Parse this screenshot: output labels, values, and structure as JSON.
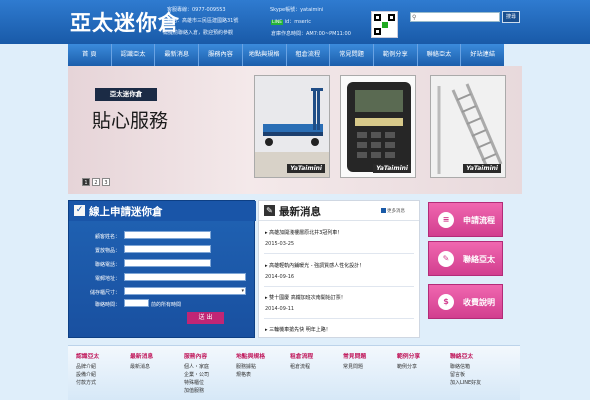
{
  "header": {
    "logo": "亞太迷你倉",
    "phone": "客服專線：0977-009553",
    "address": "地點：高雄市三民區建國路31號",
    "notice": "需提前聯絡入倉，歡迎預約參觀",
    "skype": "Skype帳號：yataimini",
    "line_label": "LINE",
    "line_id": "id：mseric",
    "hours": "倉庫作息時間：AM7:00~PM11:00",
    "search_btn": "搜尋"
  },
  "nav": [
    "首 頁",
    "認識亞太",
    "最新消息",
    "服務內容",
    "地點與規格",
    "租倉流程",
    "常見問題",
    "範例分享",
    "聯絡亞太",
    "好站連結"
  ],
  "banner": {
    "tag": "亞太迷你倉",
    "title": "貼心服務",
    "brand": "YaTaimini",
    "pages": [
      "1",
      "2",
      "3"
    ]
  },
  "form": {
    "title": "線上申請迷你倉",
    "fields": [
      "顧客姓名：",
      "置放物品：",
      "聯絡電話：",
      "電郵地址：",
      "儲存櫃尺寸：",
      "聯絡時間："
    ],
    "time_suffix": "前的所有時間",
    "send": "送 出"
  },
  "news": {
    "title": "最新消息",
    "more": "更多消息",
    "items": [
      {
        "title": "高雄加開淺樓層原北井3冠列車！",
        "date": "2015-03-25"
      },
      {
        "title": "高雄輕軌內鋪暖光 - 強調質感人性化設計！",
        "date": "2014-09-16"
      },
      {
        "title": "雙十國慶 高鐵加班次南開始訂票！",
        "date": "2014-09-11"
      },
      {
        "title": "三輪機車搶先快 明年上路！",
        "date": ""
      }
    ]
  },
  "side_buttons": [
    {
      "label": "申請流程",
      "icon": "≡"
    },
    {
      "label": "聯絡亞太",
      "icon": "✎"
    },
    {
      "label": "收費說明",
      "icon": "$"
    }
  ],
  "footer": [
    {
      "h": "認識亞太",
      "links": [
        "品牌介紹",
        "設備介紹",
        "付款方式"
      ]
    },
    {
      "h": "最新消息",
      "links": [
        "最新消息"
      ]
    },
    {
      "h": "服務內容",
      "links": [
        "個人・家庭",
        "企業・公司",
        "特殊櫃位",
        "加值服務"
      ]
    },
    {
      "h": "地點與規格",
      "links": [
        "服務據點",
        "規格表"
      ]
    },
    {
      "h": "租倉流程",
      "links": [
        "租倉流程"
      ]
    },
    {
      "h": "常見問題",
      "links": [
        "常見問題"
      ]
    },
    {
      "h": "範例分享",
      "links": [
        "範例分享"
      ]
    },
    {
      "h": "聯絡亞太",
      "links": [
        "聯絡信箱",
        "留言板",
        "加入LINE好友"
      ]
    }
  ]
}
